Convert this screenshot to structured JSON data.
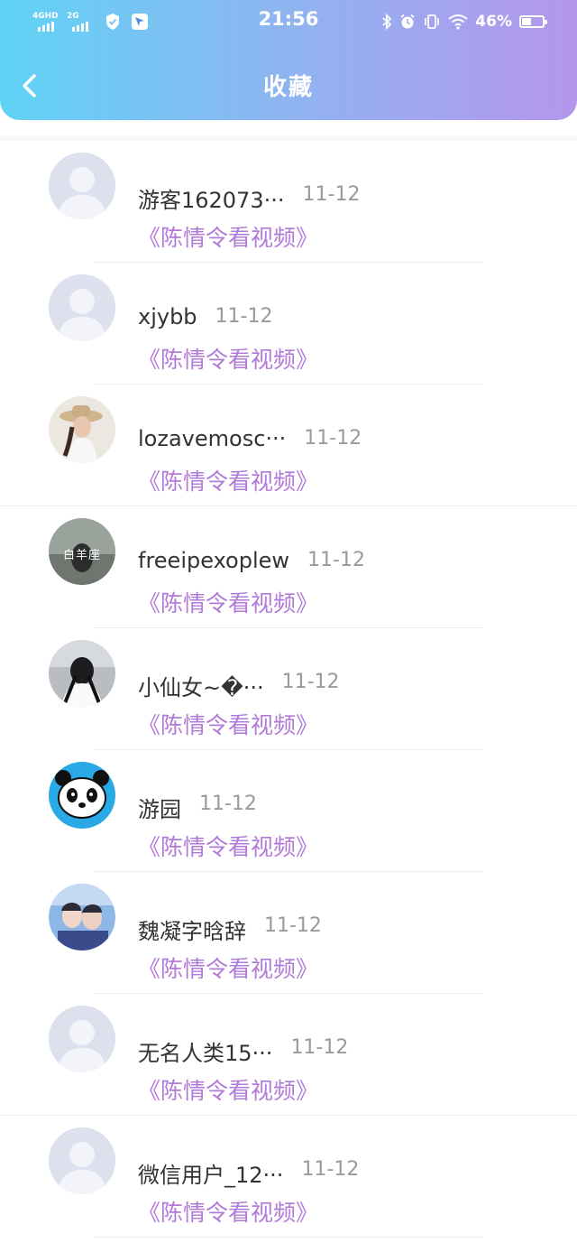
{
  "status": {
    "network_1": "4GHD",
    "network_2": "2G",
    "time": "21:56",
    "battery_percent": "46%",
    "battery_level": 0.46
  },
  "header": {
    "title": "收藏"
  },
  "colors": {
    "accent_purple": "#b27ad8",
    "header_start": "#5fd3f5",
    "header_end": "#b596ec"
  },
  "items": [
    {
      "name": "游客162073···",
      "date": "11-12",
      "video": "《陈情令看视频》",
      "avatar": "default-avatar"
    },
    {
      "name": "xjybb",
      "date": "11-12",
      "video": "《陈情令看视频》",
      "avatar": "default-avatar"
    },
    {
      "name": "lozavemosc···",
      "date": "11-12",
      "video": "《陈情令看视频》",
      "avatar": "photo-avatar"
    },
    {
      "name": "freeipexoplew",
      "date": "11-12",
      "video": "《陈情令看视频》",
      "avatar": "photo-avatar",
      "avatar_text": "白羊座"
    },
    {
      "name": "小仙女~�···",
      "date": "11-12",
      "video": "《陈情令看视频》",
      "avatar": "photo-avatar"
    },
    {
      "name": "游园",
      "date": "11-12",
      "video": "《陈情令看视频》",
      "avatar": "panda-avatar"
    },
    {
      "name": "魏凝字晗辞",
      "date": "11-12",
      "video": "《陈情令看视频》",
      "avatar": "photo-avatar"
    },
    {
      "name": "无名人类15···",
      "date": "11-12",
      "video": "《陈情令看视频》",
      "avatar": "default-avatar"
    },
    {
      "name": "微信用户_12···",
      "date": "11-12",
      "video": "《陈情令看视频》",
      "avatar": "default-avatar"
    }
  ]
}
